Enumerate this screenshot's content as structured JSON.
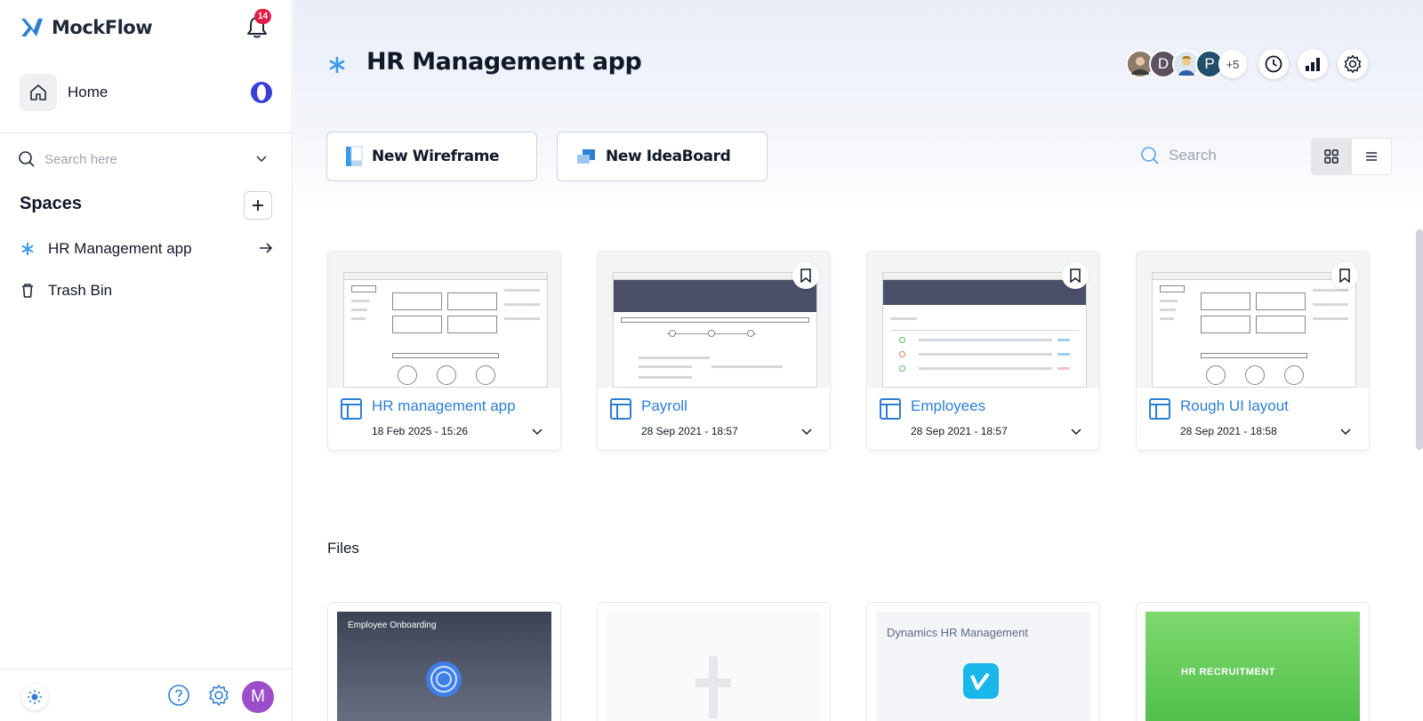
{
  "app": {
    "name": "MockFlow",
    "notifications": "14"
  },
  "sidebar": {
    "home_label": "Home",
    "search_placeholder": "Search here",
    "spaces_title": "Spaces",
    "items": [
      {
        "label": "HR Management app",
        "icon": "asterisk-icon"
      },
      {
        "label": "Trash Bin",
        "icon": "trash-icon"
      }
    ],
    "user_initial": "M"
  },
  "header": {
    "title": "HR Management app",
    "collaborators": [
      "photo",
      "D",
      "photo",
      "P"
    ],
    "more_collaborators": "+5"
  },
  "actions": {
    "new_wireframe": "New Wireframe",
    "new_ideaboard": "New IdeaBoard",
    "search_placeholder": "Search"
  },
  "projects": [
    {
      "title": "HR management app",
      "date": "18 Feb 2025 - 15:26"
    },
    {
      "title": "Payroll",
      "date": "28 Sep 2021 - 18:57"
    },
    {
      "title": "Employees",
      "date": "28 Sep 2021 - 18:57"
    },
    {
      "title": "Rough UI layout",
      "date": "28 Sep 2021 - 18:58"
    }
  ],
  "files": {
    "title": "Files",
    "items": [
      {
        "caption": "Employee Onboarding"
      },
      {
        "caption": ""
      },
      {
        "caption": "Dynamics HR Management"
      },
      {
        "caption": "HR RECRUITMENT"
      }
    ]
  },
  "colors": {
    "accent": "#2c7fd3",
    "badge": "#e11d48",
    "avatar": "#9b4dca"
  }
}
